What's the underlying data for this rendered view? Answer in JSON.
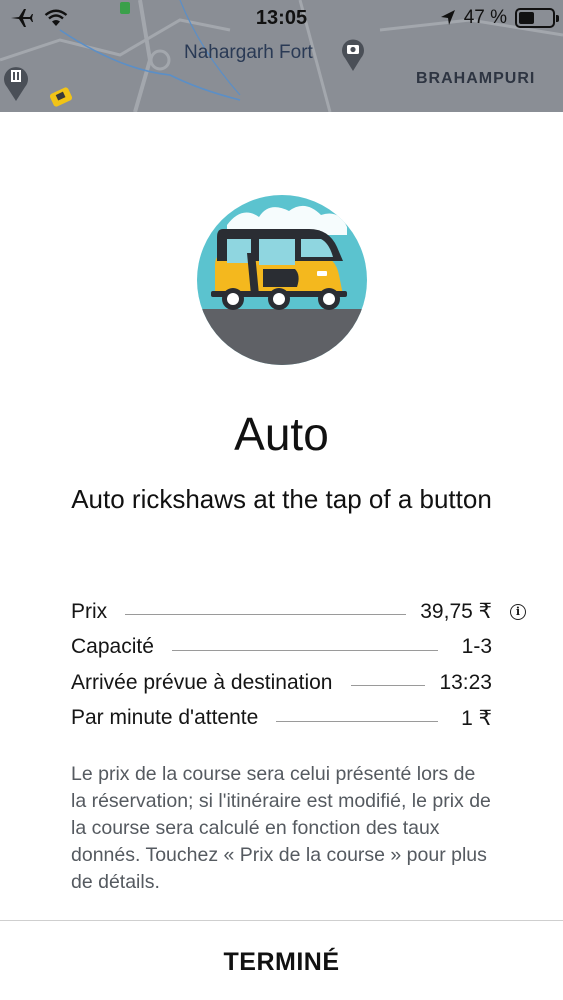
{
  "status_bar": {
    "time": "13:05",
    "battery_percent": "47 %",
    "battery_level": 0.47,
    "icons": [
      "airplane-icon",
      "wifi-icon",
      "location-arrow-icon",
      "battery-icon"
    ]
  },
  "map": {
    "place_label": "Nahargarh Fort",
    "area_label": "BRAHAMPURI",
    "colors": {
      "background": "#8a8e95",
      "roads": "#9fa3a9",
      "water": "#5b8fc7"
    }
  },
  "product": {
    "illustration": "auto-rickshaw-illustration",
    "name": "Auto",
    "tagline": "Auto rickshaws at the tap of a button"
  },
  "details": [
    {
      "label": "Prix",
      "value": "39,75 ₹",
      "has_info": true
    },
    {
      "label": "Capacité",
      "value": "1-3",
      "has_info": false
    },
    {
      "label": "Arrivée prévue à destination",
      "value": "13:23",
      "has_info": false
    },
    {
      "label": "Par minute d'attente",
      "value": "1 ₹",
      "has_info": false
    }
  ],
  "note": "Le prix de la course sera celui présenté lors de la réservation; si l'itinéraire est modifié, le prix de la course sera calculé en fonction des taux donnés. Touchez « Prix de la course » pour plus de détails.",
  "footer": {
    "done_label": "TERMINÉ"
  }
}
